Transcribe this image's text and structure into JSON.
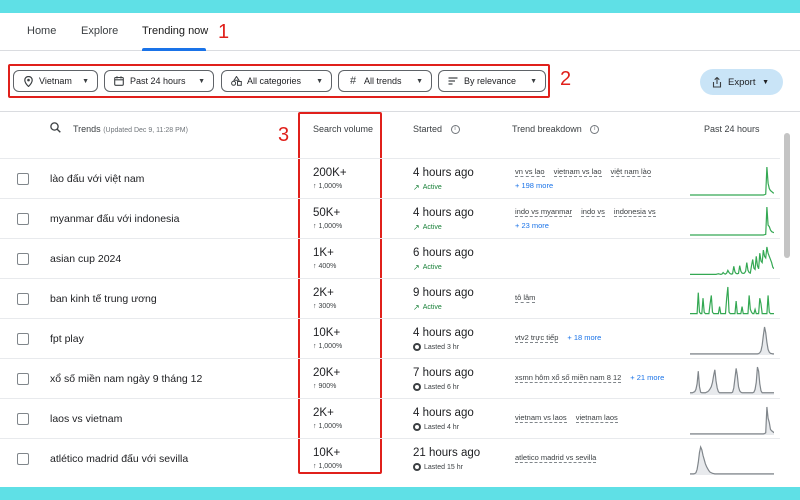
{
  "nav": {
    "tabs": [
      {
        "label": "Home"
      },
      {
        "label": "Explore"
      },
      {
        "label": "Trending now"
      }
    ]
  },
  "annotations": [
    "1",
    "2",
    "3"
  ],
  "filters": [
    {
      "label": "Vietnam",
      "icon": "location-pin-icon"
    },
    {
      "label": "Past 24 hours",
      "icon": "calendar-icon"
    },
    {
      "label": "All categories",
      "icon": "category-shapes-icon"
    },
    {
      "label": "All trends",
      "icon": "hashtag-icon"
    },
    {
      "label": "By relevance",
      "icon": "sort-lines-icon"
    }
  ],
  "export": {
    "label": "Export",
    "icon": "share-icon"
  },
  "table": {
    "headers": {
      "trends": "Trends",
      "updated": "(Updated Dec 9, 11:28 PM)",
      "search_volume": "Search volume",
      "started": "Started",
      "trend_breakdown": "Trend breakdown",
      "past_24": "Past 24 hours"
    },
    "rows": [
      {
        "trend": "lào đấu với việt nam",
        "volume": "200K+",
        "pct": "1,000%",
        "started": "4 hours ago",
        "status": "Active",
        "active": true,
        "breakdown": [
          "vn vs lao",
          "vietnam vs lao",
          "việt nam lào"
        ],
        "more": "+ 198 more",
        "spark": [
          0,
          0,
          0,
          0,
          0,
          0,
          0,
          0,
          0,
          0,
          0,
          0,
          0,
          0,
          0,
          0,
          0,
          0,
          0,
          0,
          0,
          0,
          0,
          0,
          0,
          0,
          0,
          0,
          0,
          0,
          0,
          0,
          0,
          0,
          0,
          0,
          0,
          0,
          0,
          0,
          0,
          0,
          0,
          0,
          0,
          0,
          0,
          0,
          0,
          0,
          0,
          0,
          0,
          0,
          0,
          0,
          0,
          0,
          0,
          0,
          0,
          0,
          0,
          1,
          3,
          95,
          40,
          22,
          15,
          12,
          8,
          6
        ]
      },
      {
        "trend": "myanmar đấu với indonesia",
        "volume": "50K+",
        "pct": "1,000%",
        "started": "4 hours ago",
        "status": "Active",
        "active": true,
        "breakdown": [
          "indo vs myanmar",
          "indo vs",
          "indonesia vs"
        ],
        "more": "+ 23 more",
        "spark": [
          0,
          0,
          0,
          0,
          0,
          0,
          0,
          0,
          0,
          0,
          0,
          0,
          0,
          0,
          0,
          0,
          0,
          0,
          0,
          0,
          0,
          0,
          0,
          0,
          0,
          0,
          0,
          0,
          0,
          0,
          0,
          0,
          0,
          0,
          0,
          0,
          0,
          0,
          0,
          0,
          0,
          0,
          0,
          0,
          0,
          0,
          0,
          0,
          0,
          0,
          0,
          0,
          0,
          0,
          0,
          0,
          0,
          0,
          0,
          0,
          0,
          0,
          0,
          1,
          2,
          100,
          35,
          30,
          18,
          12,
          10,
          8
        ]
      },
      {
        "trend": "asian cup 2024",
        "volume": "1K+",
        "pct": "400%",
        "started": "6 hours ago",
        "status": "Active",
        "active": true,
        "breakdown": [],
        "more": "",
        "spark": [
          2,
          2,
          2,
          2,
          2,
          2,
          2,
          2,
          2,
          2,
          2,
          2,
          2,
          2,
          2,
          2,
          2,
          2,
          2,
          2,
          2,
          2,
          2,
          3,
          4,
          3,
          2,
          3,
          8,
          4,
          3,
          6,
          15,
          8,
          4,
          3,
          4,
          28,
          10,
          5,
          4,
          5,
          30,
          12,
          6,
          5,
          6,
          12,
          40,
          15,
          8,
          6,
          30,
          50,
          22,
          18,
          60,
          30,
          20,
          70,
          45,
          40,
          80,
          60,
          55,
          90,
          70,
          60,
          50,
          40,
          25,
          20
        ]
      },
      {
        "trend": "ban kinh tế trung ương",
        "volume": "2K+",
        "pct": "300%",
        "started": "9 hours ago",
        "status": "Active",
        "active": true,
        "breakdown": [
          "tô lâm"
        ],
        "more": "",
        "spark": [
          5,
          5,
          5,
          5,
          5,
          5,
          5,
          80,
          10,
          5,
          5,
          60,
          10,
          5,
          5,
          5,
          5,
          40,
          70,
          10,
          5,
          5,
          5,
          5,
          5,
          30,
          5,
          5,
          5,
          5,
          5,
          60,
          100,
          10,
          5,
          5,
          5,
          5,
          5,
          50,
          5,
          5,
          5,
          5,
          30,
          5,
          5,
          5,
          5,
          5,
          70,
          20,
          10,
          5,
          5,
          20,
          5,
          5,
          5,
          60,
          40,
          5,
          5,
          5,
          5,
          5,
          70,
          10,
          5,
          5,
          5,
          5
        ]
      },
      {
        "trend": "fpt play",
        "volume": "10K+",
        "pct": "1,000%",
        "started": "4 hours ago",
        "status": "Lasted 3 hr",
        "active": false,
        "breakdown": [
          "vtv2 trực tiếp"
        ],
        "more": "+ 18 more",
        "spark": [
          4,
          4,
          4,
          4,
          4,
          4,
          4,
          4,
          4,
          4,
          4,
          4,
          4,
          4,
          4,
          4,
          4,
          4,
          4,
          4,
          4,
          4,
          4,
          4,
          4,
          4,
          4,
          4,
          4,
          4,
          4,
          4,
          4,
          4,
          4,
          4,
          4,
          4,
          4,
          4,
          4,
          4,
          4,
          4,
          4,
          4,
          4,
          4,
          4,
          4,
          4,
          4,
          4,
          4,
          4,
          4,
          4,
          4,
          5,
          8,
          15,
          35,
          70,
          100,
          80,
          45,
          20,
          10,
          6,
          5,
          4,
          4
        ]
      },
      {
        "trend": "xổ số miền nam ngày 9 tháng 12",
        "volume": "20K+",
        "pct": "900%",
        "started": "7 hours ago",
        "status": "Lasted 6 hr",
        "active": false,
        "breakdown": [
          "xsmn hôm xổ số miền nam 8 12"
        ],
        "more": "+ 21 more",
        "spark": [
          8,
          8,
          8,
          10,
          12,
          20,
          40,
          85,
          30,
          10,
          8,
          8,
          8,
          8,
          10,
          12,
          16,
          22,
          30,
          45,
          70,
          90,
          50,
          25,
          12,
          8,
          8,
          8,
          8,
          8,
          8,
          8,
          8,
          8,
          8,
          8,
          10,
          25,
          60,
          95,
          70,
          30,
          15,
          10,
          8,
          8,
          8,
          8,
          8,
          8,
          8,
          8,
          8,
          8,
          10,
          20,
          45,
          100,
          85,
          40,
          15,
          8,
          8,
          8,
          8,
          8,
          8,
          8,
          8,
          8,
          8,
          8
        ]
      },
      {
        "trend": "laos vs vietnam",
        "volume": "2K+",
        "pct": "1,000%",
        "started": "4 hours ago",
        "status": "Lasted 4 hr",
        "active": false,
        "breakdown": [
          "vietnam vs laos",
          "vietnam laos"
        ],
        "more": "",
        "spark": [
          4,
          4,
          4,
          4,
          4,
          4,
          4,
          4,
          4,
          4,
          4,
          4,
          4,
          4,
          4,
          4,
          4,
          4,
          4,
          4,
          4,
          4,
          4,
          4,
          4,
          4,
          4,
          4,
          4,
          4,
          4,
          4,
          4,
          4,
          4,
          4,
          4,
          4,
          4,
          4,
          4,
          4,
          4,
          4,
          4,
          4,
          4,
          4,
          4,
          4,
          4,
          4,
          4,
          4,
          4,
          4,
          4,
          4,
          4,
          4,
          4,
          4,
          4,
          5,
          8,
          100,
          60,
          45,
          20,
          15,
          12,
          8
        ]
      },
      {
        "trend": "atlético madrid đấu với sevilla",
        "volume": "10K+",
        "pct": "1,000%",
        "started": "21 hours ago",
        "status": "Lasted 15 hr",
        "active": false,
        "breakdown": [
          "atletico madrid vs sevilla"
        ],
        "more": "",
        "spark": [
          4,
          4,
          4,
          4,
          5,
          8,
          20,
          45,
          80,
          100,
          90,
          70,
          55,
          40,
          30,
          22,
          15,
          10,
          8,
          6,
          5,
          4,
          4,
          4,
          4,
          4,
          4,
          4,
          4,
          4,
          4,
          4,
          4,
          4,
          4,
          4,
          4,
          4,
          4,
          4,
          4,
          4,
          4,
          4,
          4,
          4,
          4,
          4,
          4,
          4,
          4,
          4,
          4,
          4,
          4,
          4,
          4,
          4,
          4,
          4,
          4,
          4,
          4,
          4,
          4,
          4,
          4,
          4,
          4,
          4,
          4,
          4
        ]
      }
    ]
  },
  "colors": {
    "accent": "#1a73e8",
    "active_green": "#188038",
    "spark_green": "#34a853",
    "spark_gray": "#80868b",
    "annotation_red": "#e0201b",
    "frame_bg": "#5fe0e6",
    "export_bg": "#c9e4f7"
  }
}
